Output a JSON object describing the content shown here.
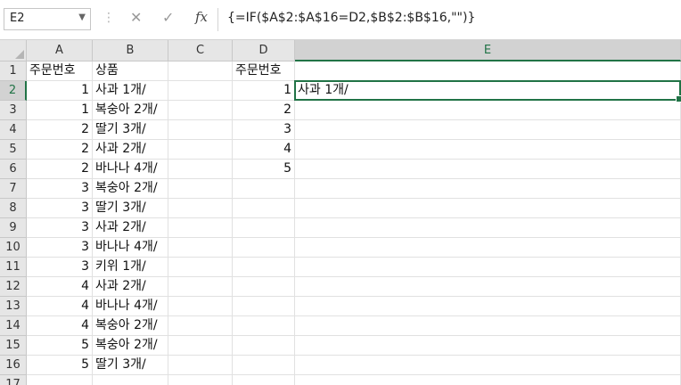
{
  "formula_bar": {
    "name_box": "E2",
    "formula": "{=IF($A$2:$A$16=D2,$B$2:$B$16,\"\")}",
    "cancel_icon": "✕",
    "enter_icon": "✓",
    "function_icon": "fx"
  },
  "columns": [
    "A",
    "B",
    "C",
    "D",
    "E"
  ],
  "rows": [
    "1",
    "2",
    "3",
    "4",
    "5",
    "6",
    "7",
    "8",
    "9",
    "10",
    "11",
    "12",
    "13",
    "14",
    "15",
    "16",
    "17"
  ],
  "cells": {
    "A1": "주문번호",
    "B1": "상품",
    "D1": "주문번호",
    "A2": "1",
    "B2": "사과 1개/",
    "A3": "1",
    "B3": "복숭아 2개/",
    "A4": "2",
    "B4": "딸기 3개/",
    "A5": "2",
    "B5": "사과 2개/",
    "A6": "2",
    "B6": "바나나 4개/",
    "A7": "3",
    "B7": "복숭아 2개/",
    "A8": "3",
    "B8": "딸기 3개/",
    "A9": "3",
    "B9": "사과 2개/",
    "A10": "3",
    "B10": "바나나 4개/",
    "A11": "3",
    "B11": "키위 1개/",
    "A12": "4",
    "B12": "사과 2개/",
    "A13": "4",
    "B13": "바나나 4개/",
    "A14": "4",
    "B14": "복숭아 2개/",
    "A15": "5",
    "B15": "복숭아 2개/",
    "A16": "5",
    "B16": "딸기 3개/",
    "D2": "1",
    "D3": "2",
    "D4": "3",
    "D5": "4",
    "D6": "5",
    "E2": "사과 1개/"
  },
  "selection": {
    "active_cell": "E2",
    "accent_color": "#217346"
  }
}
